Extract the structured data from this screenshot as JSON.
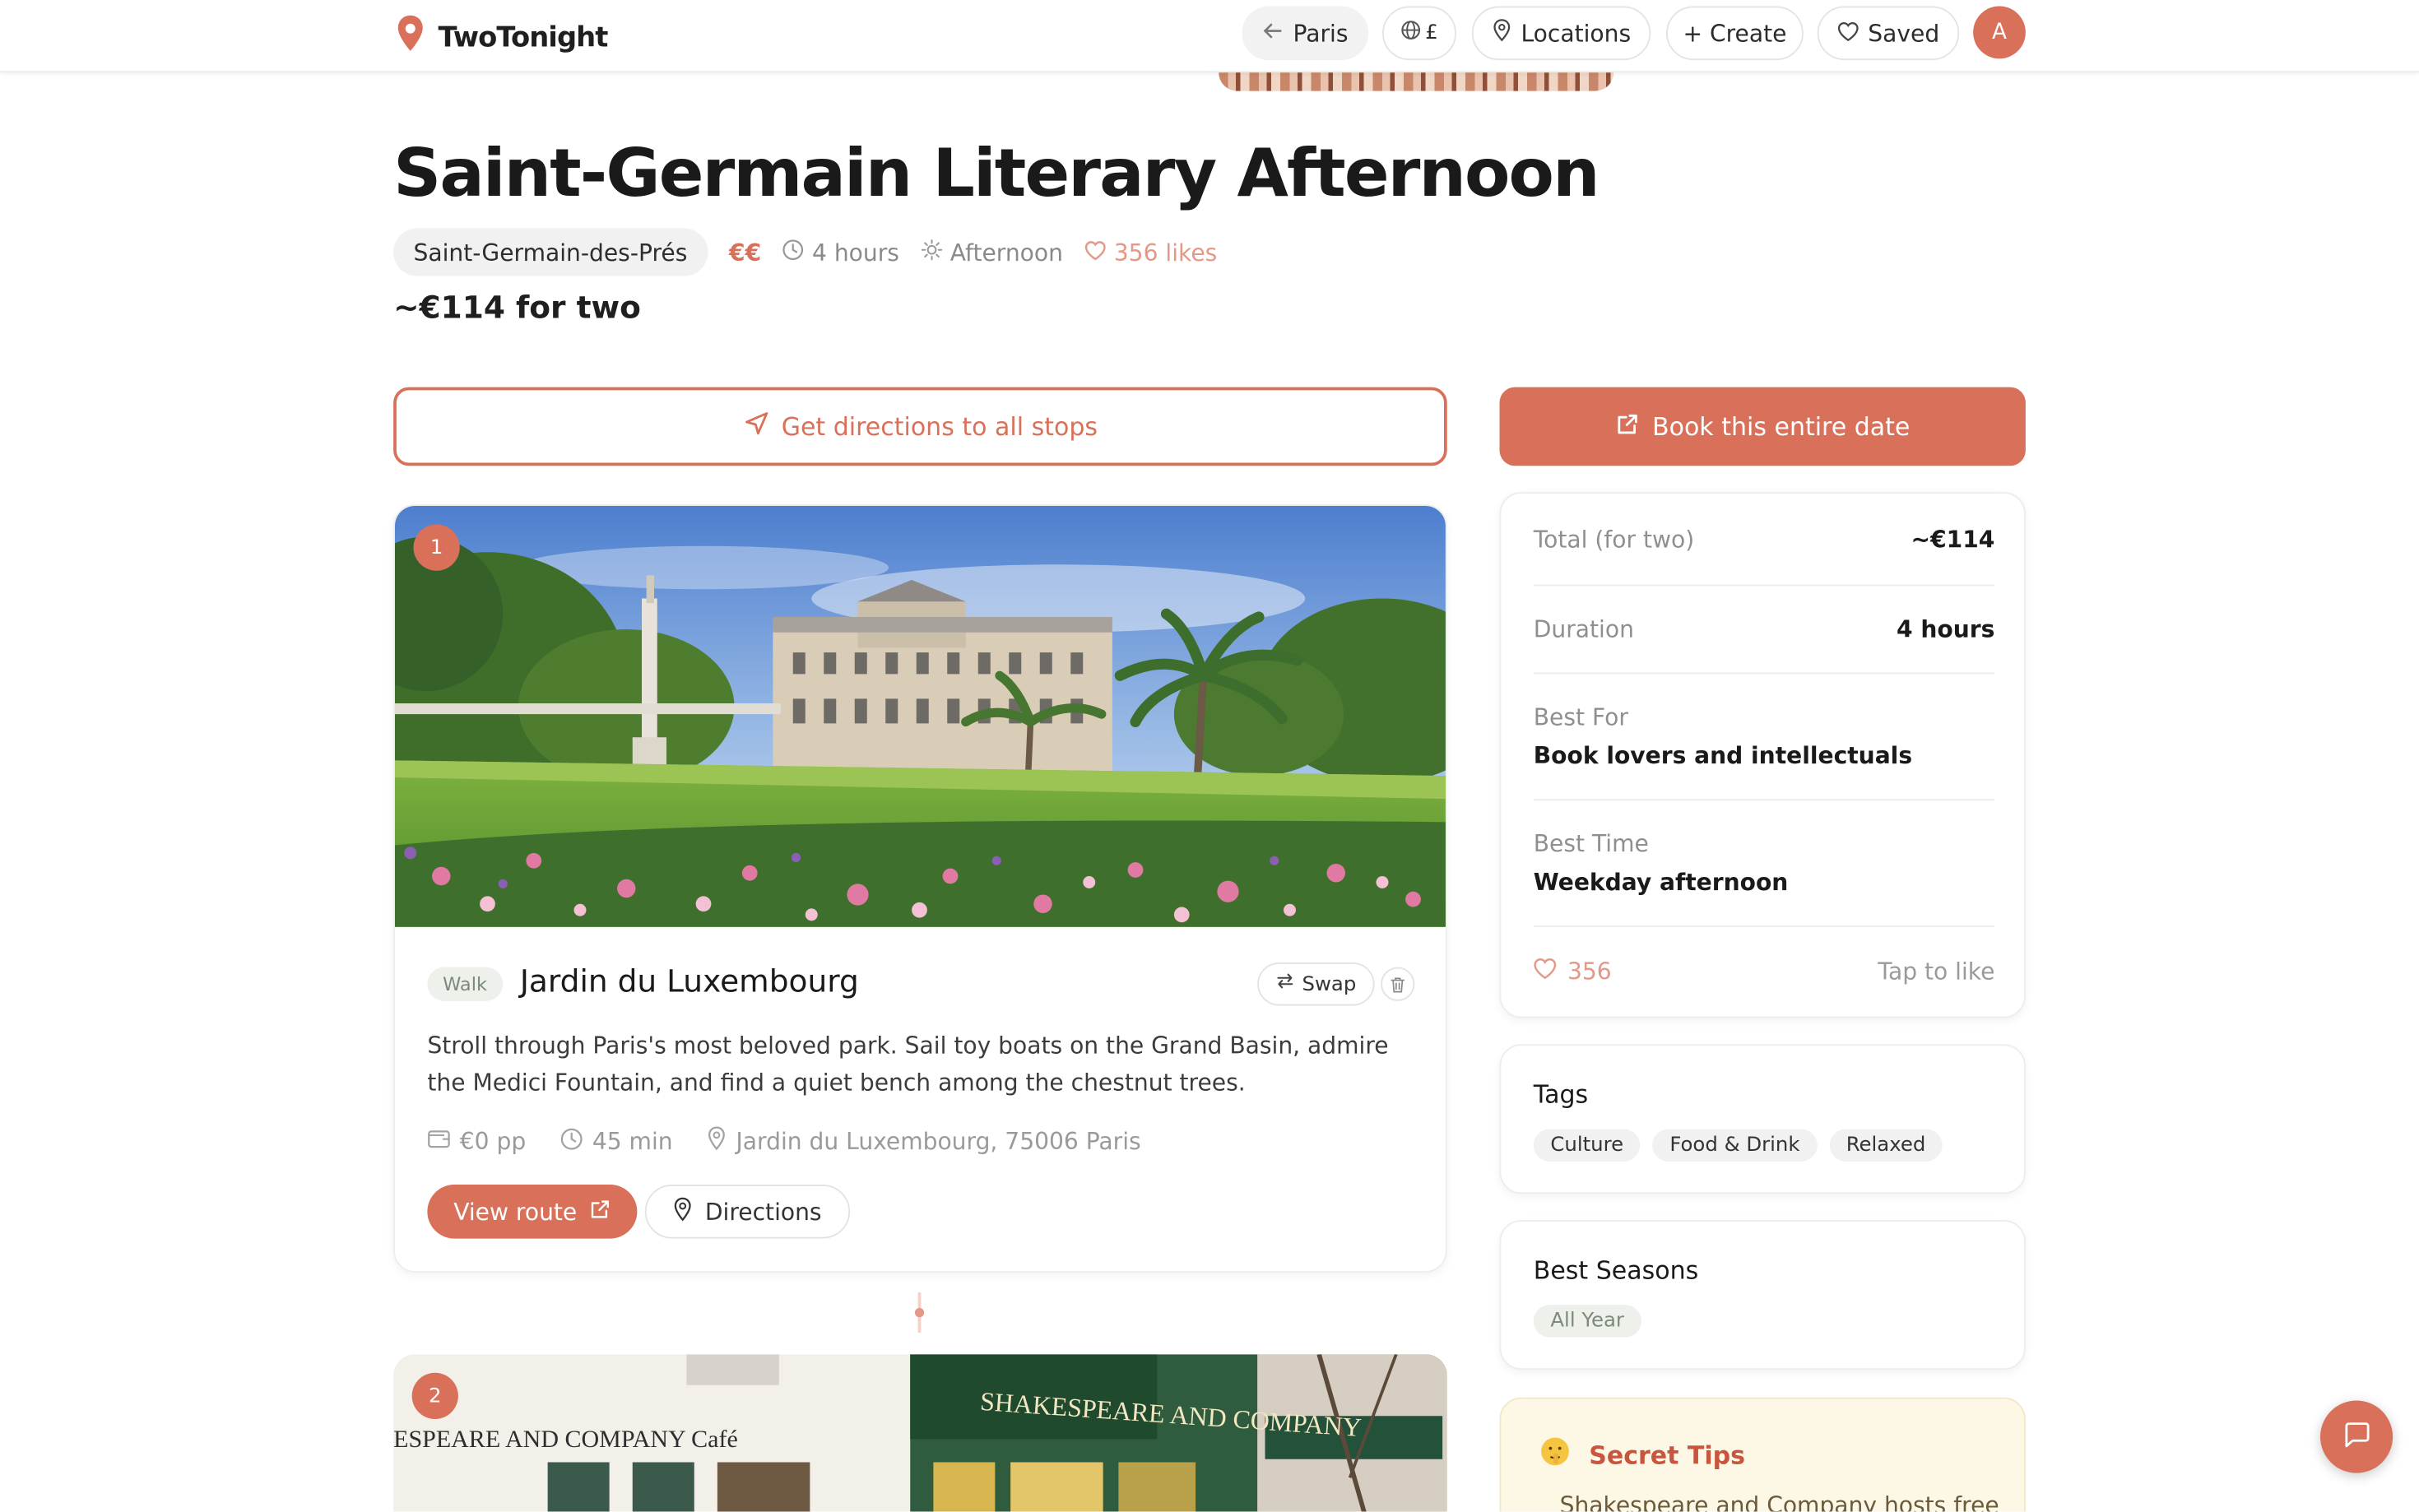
{
  "app": {
    "name": "TwoTonight"
  },
  "nav": {
    "city": "Paris",
    "currency_symbol": "£",
    "locations": "Locations",
    "create": "+ Create",
    "saved": "Saved",
    "avatar_initial": "A"
  },
  "date": {
    "title": "Saint-Germain Literary Afternoon",
    "neighborhood": "Saint-Germain-des-Prés",
    "price_level": "€€",
    "duration": "4 hours",
    "time_of_day": "Afternoon",
    "likes": "356 likes",
    "approx_cost": "~€114 for two"
  },
  "actions": {
    "directions_all": "Get directions to all stops",
    "book_all": "Book this entire date"
  },
  "stops": [
    {
      "number": "1",
      "type": "Walk",
      "name": "Jardin du Luxembourg",
      "swap_label": "Swap",
      "description": "Stroll through Paris's most beloved park. Sail toy boats on the Grand Basin, admire the Medici Fountain, and find a quiet bench among the chestnut trees.",
      "price": "€0 pp",
      "duration": "45 min",
      "address": "Jardin du Luxembourg, 75006 Paris",
      "view_route": "View route",
      "directions": "Directions"
    },
    {
      "number": "2",
      "sign_text": "SHAKESPEARE AND COMPANY",
      "left_sign_text": "ESPEARE AND COMPANY Café"
    }
  ],
  "summary": {
    "total_label": "Total (for two)",
    "total_value": "~€114",
    "duration_label": "Duration",
    "duration_value": "4 hours",
    "best_for_label": "Best For",
    "best_for_value": "Book lovers and intellectuals",
    "best_time_label": "Best Time",
    "best_time_value": "Weekday afternoon",
    "likes_count": "356",
    "tap_to_like": "Tap to like"
  },
  "tags": {
    "title": "Tags",
    "items": [
      "Culture",
      "Food & Drink",
      "Relaxed"
    ]
  },
  "seasons": {
    "title": "Best Seasons",
    "items": [
      "All Year"
    ]
  },
  "tips": {
    "title": "Secret Tips",
    "text": "Shakespeare and Company hosts free"
  },
  "colors": {
    "accent": "#d9705a",
    "accent_light": "#e49888",
    "tips_bg": "#fdf8e6"
  }
}
